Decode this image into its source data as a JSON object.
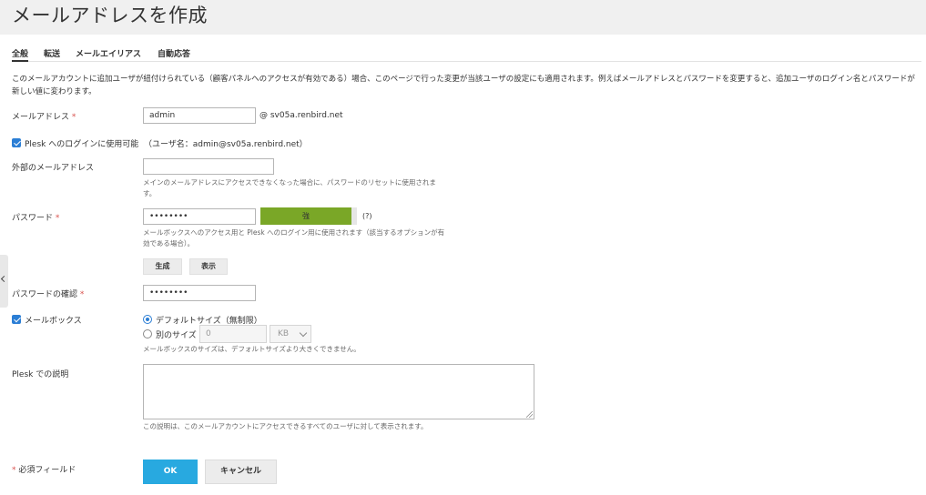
{
  "header": {
    "title": "メールアドレスを作成"
  },
  "tabs": [
    {
      "label": "全般",
      "active": true
    },
    {
      "label": "転送",
      "active": false
    },
    {
      "label": "メールエイリアス",
      "active": false
    },
    {
      "label": "自動応答",
      "active": false
    }
  ],
  "intro": "このメールアカウントに追加ユーザが紐付けられている（顧客パネルへのアクセスが有効である）場合、このページで行った変更が当該ユーザの設定にも適用されます。例えばメールアドレスとパスワードを変更すると、追加ユーザのログイン名とパスワードが新しい値に変わります。",
  "form": {
    "email": {
      "label": "メールアドレス",
      "required_mark": "*",
      "value": "admin",
      "domain": "@ sv05a.renbird.net"
    },
    "plesk_login": {
      "checked": true,
      "label": "Plesk へのログインに使用可能",
      "username_note": "（ユーザ名：admin@sv05a.renbird.net）"
    },
    "external_email": {
      "label": "外部のメールアドレス",
      "value": "",
      "hint": "メインのメールアドレスにアクセスできなくなった場合に、パスワードのリセットに使用されます。"
    },
    "password": {
      "label": "パスワード",
      "required_mark": "*",
      "value": "••••••••",
      "strength_label": "強",
      "strength_fraction": 0.94,
      "help": "(?)",
      "hint": "メールボックスへのアクセス用と Plesk へのログイン用に使用されます（該当するオプションが有効である場合）。",
      "generate_button": "生成",
      "show_button": "表示"
    },
    "password_confirm": {
      "label": "パスワードの確認",
      "required_mark": "*",
      "value": "••••••••"
    },
    "mailbox": {
      "checked": true,
      "label": "メールボックス",
      "default_size_label": "デフォルトサイズ（無制限）",
      "other_size_label": "別のサイズ",
      "other_size_value": "0",
      "unit": "KB",
      "hint": "メールボックスのサイズは、デフォルトサイズより大きくできません。"
    },
    "description": {
      "label": "Plesk での説明",
      "value": "",
      "hint": "この説明は、このメールアカウントにアクセスできるすべてのユーザに対して表示されます。"
    },
    "required_note": {
      "mark": "*",
      "text": "必須フィールド"
    },
    "ok_button": "OK",
    "cancel_button": "キャンセル"
  },
  "colors": {
    "primary": "#28a9e0",
    "strength": "#7aa727",
    "required": "#d9534f",
    "checkbox": "#2b7ed5"
  }
}
